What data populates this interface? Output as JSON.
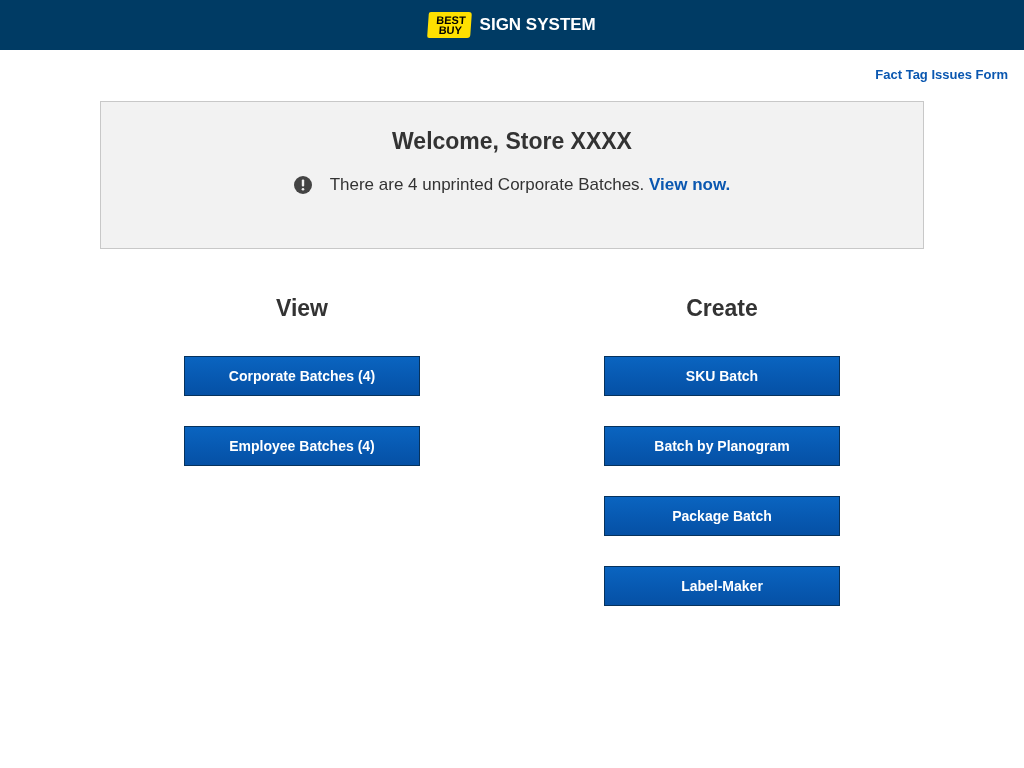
{
  "header": {
    "logo": [
      "BEST",
      "BUY"
    ],
    "title": "SIGN SYSTEM"
  },
  "top_link": "Fact Tag Issues Form",
  "welcome": {
    "title": "Welcome, Store XXXX",
    "message": "There are 4 unprinted Corporate Batches.",
    "link": "View now."
  },
  "columns": [
    {
      "heading": "View",
      "buttons": [
        "Corporate Batches (4)",
        "Employee Batches (4)"
      ]
    },
    {
      "heading": "Create",
      "buttons": [
        "SKU Batch",
        "Batch by Planogram",
        "Package Batch",
        "Label-Maker"
      ]
    }
  ]
}
